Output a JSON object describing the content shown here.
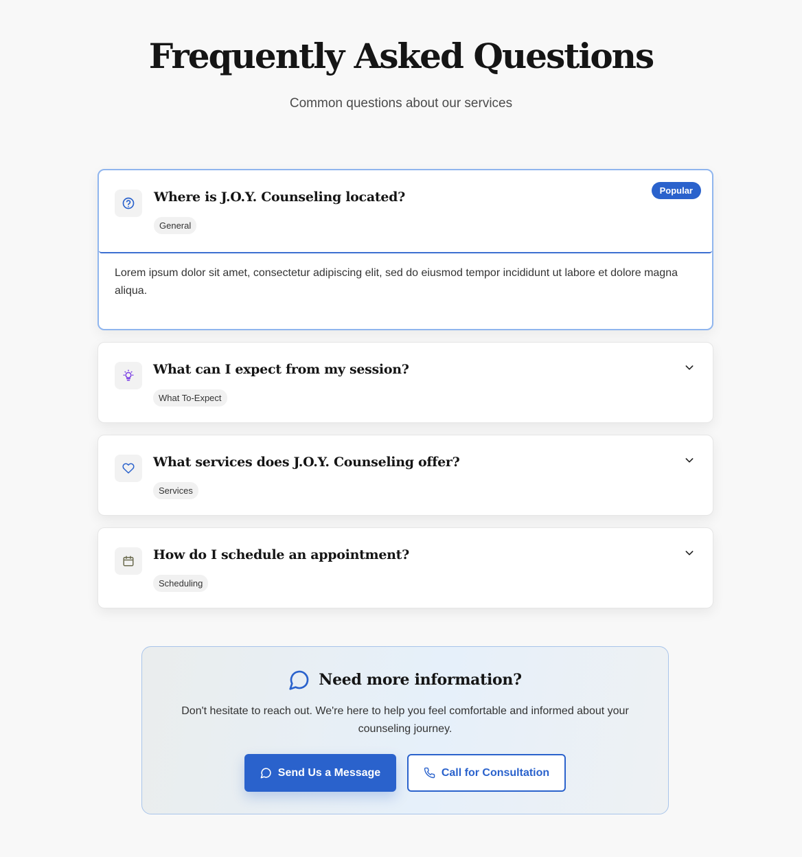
{
  "header": {
    "title": "Frequently Asked Questions",
    "subtitle": "Common questions about our services"
  },
  "faqs": [
    {
      "question": "Where is J.O.Y. Counseling located?",
      "tag": "General",
      "icon": "question-circle-icon",
      "badge": "Popular",
      "expanded": true,
      "answer": "Lorem ipsum dolor sit amet, consectetur adipiscing elit, sed do eiusmod tempor incididunt ut labore et dolore magna aliqua."
    },
    {
      "question": "What can I expect from my session?",
      "tag": "What To-Expect",
      "icon": "lightbulb-icon",
      "expanded": false
    },
    {
      "question": "What services does J.O.Y. Counseling offer?",
      "tag": "Services",
      "icon": "heart-icon",
      "expanded": false
    },
    {
      "question": "How do I schedule an appointment?",
      "tag": "Scheduling",
      "icon": "calendar-icon",
      "expanded": false
    }
  ],
  "cta": {
    "title": "Need more information?",
    "text": "Don't hesitate to reach out. We're here to help you feel comfortable and informed about your counseling journey.",
    "primary_label": "Send Us a Message",
    "secondary_label": "Call for Consultation"
  },
  "colors": {
    "accent": "#2a62cc",
    "open_border": "#8fb5ee",
    "lightbulb": "#7b3fe4",
    "calendar": "#6b6b4f"
  }
}
